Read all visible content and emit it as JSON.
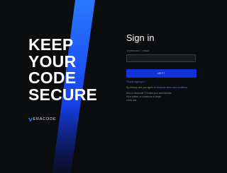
{
  "hero": {
    "lines": [
      "KEEP",
      "YOUR",
      "CODE",
      "SECURE"
    ]
  },
  "brand": {
    "logo_text": "ERACODE",
    "stripe_color_top": "#1f6bff",
    "stripe_color_bottom": "#0a1fd0",
    "accent_button": "#1231d8"
  },
  "signin": {
    "title": "Sign in",
    "field_label": "Username / email",
    "field_value": "",
    "next_label": "NEXT",
    "trouble_link": "Trouble signing in?",
    "agree_text": "By clicking next, you agree to",
    "agree_link": "Veracode terms and conditions",
    "help_line_1": "New to Veracode? Contact your administrator",
    "help_line_2": "to be added, or contact us to begin",
    "help_line_3": "a free trial."
  }
}
